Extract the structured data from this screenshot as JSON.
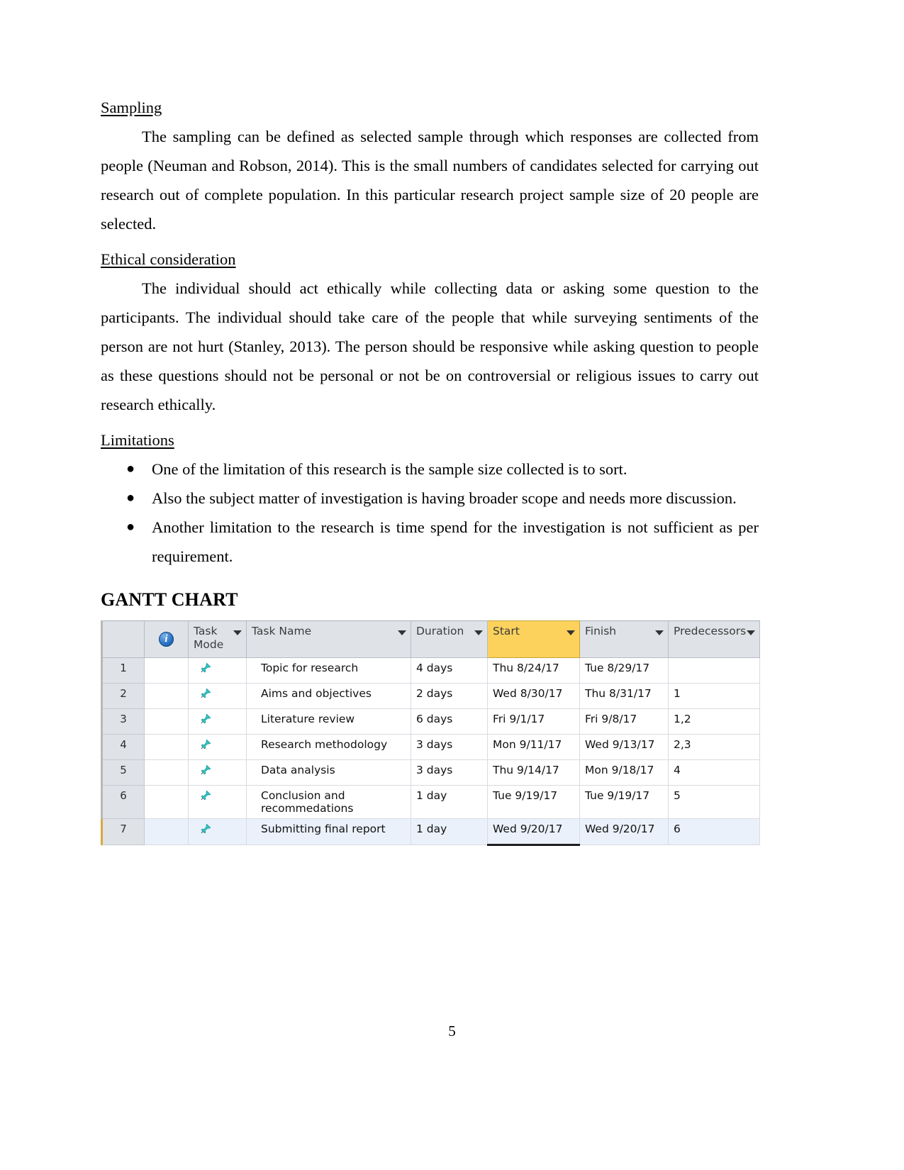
{
  "document": {
    "sections": [
      {
        "heading": "Sampling",
        "paragraphs": [
          "The sampling can be defined as selected sample through which responses are collected from people (Neuman and Robson, 2014). This is the small numbers of candidates selected for carrying out research out of complete population. In this particular research project sample size of 20 people are selected."
        ]
      },
      {
        "heading": "Ethical consideration",
        "paragraphs": [
          "The individual should act ethically while collecting data or asking some question to the participants. The individual should take care of the people that while surveying sentiments of the person are not hurt (Stanley, 2013). The person should be responsive while asking question to people as these questions should not be personal or not be on controversial or religious issues to carry out research ethically."
        ]
      },
      {
        "heading": "Limitations",
        "bullets": [
          "One of the limitation of this research is the sample size collected is to sort.",
          "Also the subject matter of investigation is having broader scope and needs more discussion.",
          "Another limitation to the research is time spend for the investigation is not sufficient as per requirement."
        ]
      }
    ],
    "gantt_title": "GANTT CHART",
    "page_number": "5"
  },
  "gantt_table": {
    "columns": [
      {
        "key": "id",
        "label": "",
        "caret": false,
        "highlighted": false
      },
      {
        "key": "info",
        "label": "",
        "caret": false,
        "highlighted": false,
        "icon": "info-icon"
      },
      {
        "key": "task_mode",
        "label": "Task Mode",
        "caret": true,
        "highlighted": false
      },
      {
        "key": "task_name",
        "label": "Task Name",
        "caret": true,
        "highlighted": false
      },
      {
        "key": "duration",
        "label": "Duration",
        "caret": true,
        "highlighted": false
      },
      {
        "key": "start",
        "label": "Start",
        "caret": true,
        "highlighted": true
      },
      {
        "key": "finish",
        "label": "Finish",
        "caret": true,
        "highlighted": false
      },
      {
        "key": "predecessors",
        "label": "Predecessors",
        "caret": true,
        "highlighted": false
      }
    ],
    "selected_row_index": 6,
    "highlight_color": "#fcd25c",
    "header_bg": "#dfe3e8",
    "pin_color": "#2fc4c4",
    "rows": [
      {
        "id": "1",
        "mode_icon": "pushpin-icon",
        "task_name": "Topic for research",
        "duration": "4 days",
        "start": "Thu 8/24/17",
        "finish": "Tue 8/29/17",
        "predecessors": ""
      },
      {
        "id": "2",
        "mode_icon": "pushpin-icon",
        "task_name": "Aims and objectives",
        "duration": "2 days",
        "start": "Wed 8/30/17",
        "finish": "Thu 8/31/17",
        "predecessors": "1"
      },
      {
        "id": "3",
        "mode_icon": "pushpin-icon",
        "task_name": "Literature review",
        "duration": "6 days",
        "start": "Fri 9/1/17",
        "finish": "Fri 9/8/17",
        "predecessors": "1,2"
      },
      {
        "id": "4",
        "mode_icon": "pushpin-icon",
        "task_name": "Research methodology",
        "duration": "3 days",
        "start": "Mon 9/11/17",
        "finish": "Wed 9/13/17",
        "predecessors": "2,3"
      },
      {
        "id": "5",
        "mode_icon": "pushpin-icon",
        "task_name": "Data analysis",
        "duration": "3 days",
        "start": "Thu 9/14/17",
        "finish": "Mon 9/18/17",
        "predecessors": "4"
      },
      {
        "id": "6",
        "mode_icon": "pushpin-icon",
        "task_name": "Conclusion and recommedations",
        "duration": "1 day",
        "start": "Tue 9/19/17",
        "finish": "Tue 9/19/17",
        "predecessors": "5"
      },
      {
        "id": "7",
        "mode_icon": "pushpin-icon",
        "task_name": "Submitting final report",
        "duration": "1 day",
        "start": "Wed 9/20/17",
        "finish": "Wed 9/20/17",
        "predecessors": "6"
      }
    ]
  }
}
